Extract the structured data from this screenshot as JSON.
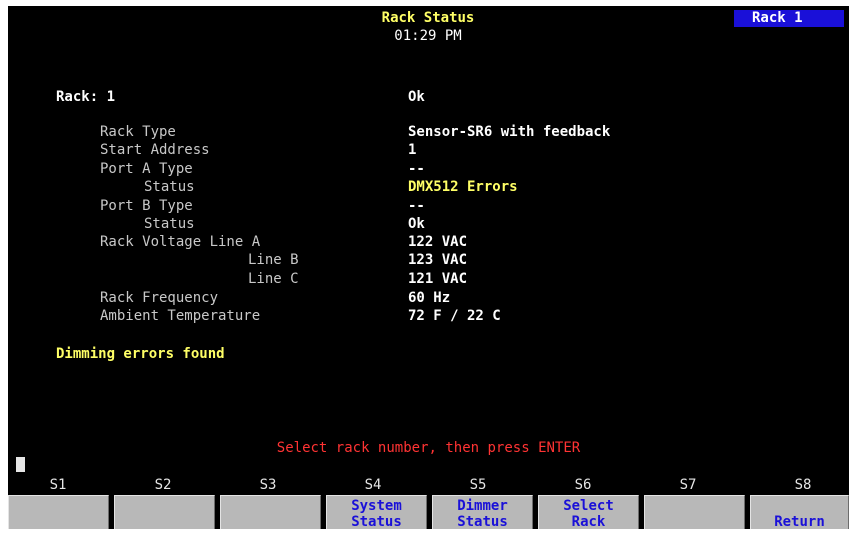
{
  "header": {
    "title": "Rack Status",
    "time": "01:29 PM",
    "rack_indicator": "Rack 1"
  },
  "rack": {
    "label": "Rack: 1",
    "status": "Ok"
  },
  "details": [
    {
      "label": "Rack Type",
      "value": "Sensor-SR6 with feedback"
    },
    {
      "label": "Start Address",
      "value": "1"
    },
    {
      "label": "Port A Type",
      "value": "--"
    },
    {
      "label": "Status",
      "value": "DMX512 Errors"
    },
    {
      "label": "Port B Type",
      "value": "--"
    },
    {
      "label": "Status",
      "value": "Ok"
    },
    {
      "label": "Rack Voltage Line A",
      "value": "122 VAC"
    },
    {
      "label": "Line B",
      "value": "123 VAC"
    },
    {
      "label": "Line C",
      "value": "121 VAC"
    },
    {
      "label": "Rack Frequency",
      "value": "60 Hz"
    },
    {
      "label": "Ambient Temperature",
      "value": "72 F / 22 C"
    }
  ],
  "message": "Dimming errors found",
  "prompt": "Select rack number, then press ENTER",
  "softkeys": [
    {
      "id": "S1",
      "line1": "",
      "line2": ""
    },
    {
      "id": "S2",
      "line1": "",
      "line2": ""
    },
    {
      "id": "S3",
      "line1": "",
      "line2": ""
    },
    {
      "id": "S4",
      "line1": "System",
      "line2": "Status"
    },
    {
      "id": "S5",
      "line1": "Dimmer",
      "line2": "Status"
    },
    {
      "id": "S6",
      "line1": "Select",
      "line2": "Rack"
    },
    {
      "id": "S7",
      "line1": "",
      "line2": ""
    },
    {
      "id": "S8",
      "line1": "",
      "line2": "Return"
    }
  ],
  "colors": {
    "background": "#000000",
    "title": "#ffff66",
    "error": "#ffff66",
    "prompt": "#ff3333",
    "indicator_bg": "#1a10d8",
    "softkey_bg": "#b8b8b8",
    "softkey_text": "#1a10d8"
  }
}
